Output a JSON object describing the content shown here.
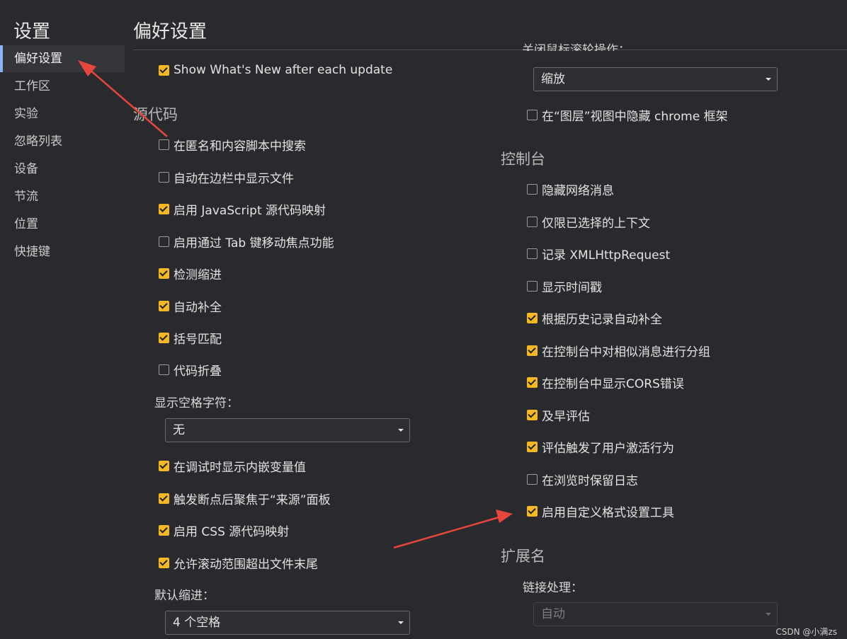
{
  "sidebar": {
    "title": "设置",
    "items": [
      {
        "label": "偏好设置",
        "active": true
      },
      {
        "label": "工作区"
      },
      {
        "label": "实验"
      },
      {
        "label": "忽略列表"
      },
      {
        "label": "设备"
      },
      {
        "label": "节流"
      },
      {
        "label": "位置"
      },
      {
        "label": "快捷键"
      }
    ]
  },
  "header": {
    "title": "偏好设置"
  },
  "left": {
    "top_check": {
      "label": "Show What's New after each update",
      "checked": true
    },
    "sources_title": "源代码",
    "checks": [
      {
        "label": "在匿名和内容脚本中搜索",
        "checked": false
      },
      {
        "label": "自动在边栏中显示文件",
        "checked": false
      },
      {
        "label": "启用 JavaScript 源代码映射",
        "checked": true
      },
      {
        "label": "启用通过 Tab 键移动焦点功能",
        "checked": false
      },
      {
        "label": "检测缩进",
        "checked": true
      },
      {
        "label": "自动补全",
        "checked": true
      },
      {
        "label": "括号匹配",
        "checked": true
      },
      {
        "label": "代码折叠",
        "checked": false
      }
    ],
    "whitespace_label": "显示空格字符：",
    "whitespace_value": "无",
    "checks2": [
      {
        "label": "在调试时显示内嵌变量值",
        "checked": true
      },
      {
        "label": "触发断点后聚焦于“来源”面板",
        "checked": true
      },
      {
        "label": "启用 CSS 源代码映射",
        "checked": true
      },
      {
        "label": "允许滚动范围超出文件末尾",
        "checked": true
      }
    ],
    "indent_label": "默认缩进：",
    "indent_value": "4 个空格"
  },
  "right": {
    "partial_label": "关闭鼠标滚轮操作：",
    "wheel_value": "缩放",
    "hide_chrome": {
      "label": "在“图层”视图中隐藏 chrome 框架",
      "checked": false
    },
    "console_title": "控制台",
    "checks": [
      {
        "label": "隐藏网络消息",
        "checked": false
      },
      {
        "label": "仅限已选择的上下文",
        "checked": false
      },
      {
        "label": "记录 XMLHttpRequest",
        "checked": false
      },
      {
        "label": "显示时间戳",
        "checked": false
      },
      {
        "label": "根据历史记录自动补全",
        "checked": true
      },
      {
        "label": "在控制台中对相似消息进行分组",
        "checked": true
      },
      {
        "label": "在控制台中显示CORS错误",
        "checked": true
      },
      {
        "label": "及早评估",
        "checked": true
      },
      {
        "label": "评估触发了用户激活行为",
        "checked": true
      },
      {
        "label": "在浏览时保留日志",
        "checked": false
      },
      {
        "label": "启用自定义格式设置工具",
        "checked": true
      }
    ],
    "extensions_title": "扩展名",
    "link_label": "链接处理：",
    "link_value": "自动"
  },
  "watermark": "CSDN @小满zs",
  "colors": {
    "checkbox_on": "#f5b722",
    "arrow": "#e8453c",
    "background": "#292a2d"
  }
}
